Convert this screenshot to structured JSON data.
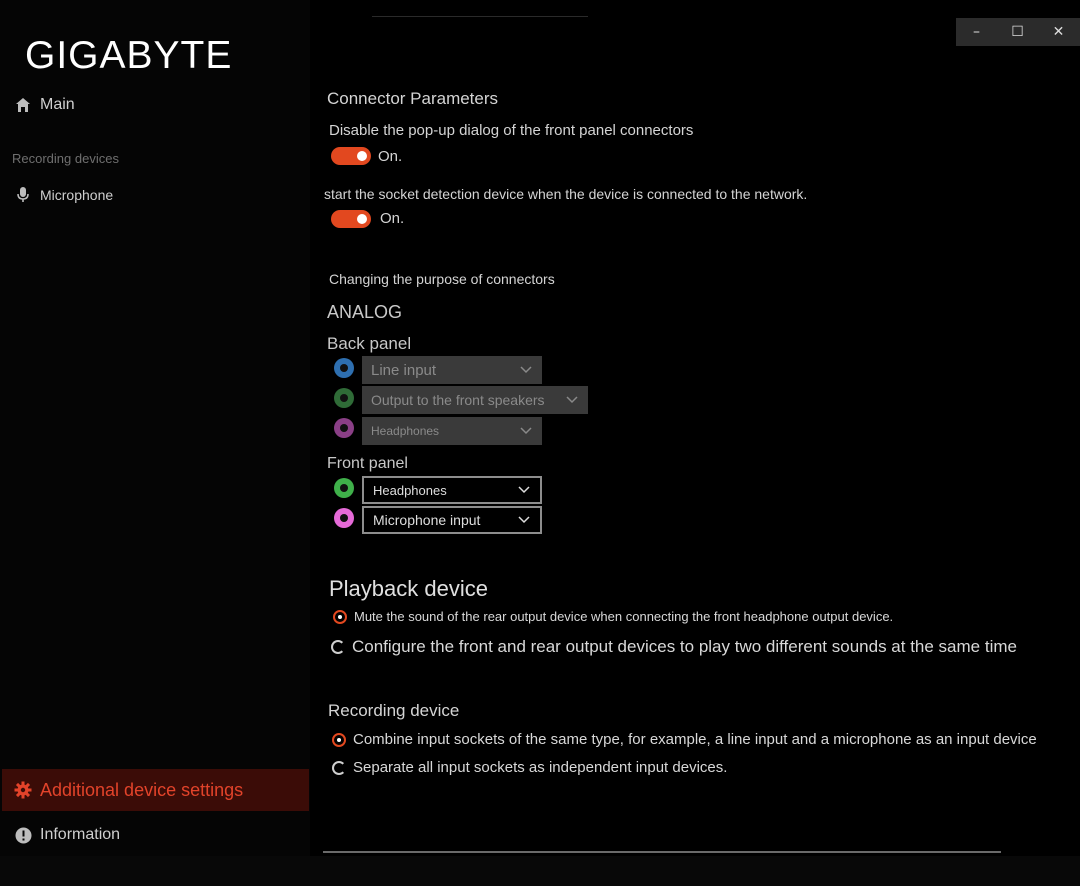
{
  "window": {
    "minimize": "–",
    "maximize": "☐",
    "close": "✕"
  },
  "sidebar": {
    "logo": "GIGABYTE",
    "main_label": "Main",
    "recording_section": "Recording devices",
    "microphone_label": "Microphone",
    "additional_label": "Additional device settings",
    "information_label": "Information"
  },
  "connector": {
    "title": "Connector Parameters",
    "popup_label": "Disable the pop-up dialog of the front panel connectors",
    "popup_state": "On.",
    "socket_label": "start the socket detection device when the device is connected to the network.",
    "socket_state": "On."
  },
  "purpose": {
    "title": "Changing the purpose of connectors",
    "analog": "ANALOG",
    "back_panel": "Back panel",
    "back_selects": [
      "Line input",
      "Output to the front speakers",
      "Headphones"
    ],
    "front_panel": "Front panel",
    "front_selects": [
      "Headphones",
      "Microphone input"
    ]
  },
  "playback": {
    "title": "Playback device",
    "option1": "Mute the sound of the rear output device when connecting the front headphone output device.",
    "option2": "Configure the front and rear output devices to play two different sounds at the same time"
  },
  "recording": {
    "title": "Recording device",
    "option1": "Combine input sockets of the same type, for example, a line input and a microphone as an input device",
    "option2": "Separate all input sockets as independent input devices."
  },
  "colors": {
    "accent": "#e2481f",
    "active_bg": "#3b0c07",
    "jack_blue": "#2e6fb0",
    "jack_green_dim": "#2f6b37",
    "jack_pink_dim": "#8a3f86",
    "jack_green": "#3fb04a",
    "jack_pink": "#e66ad8"
  }
}
